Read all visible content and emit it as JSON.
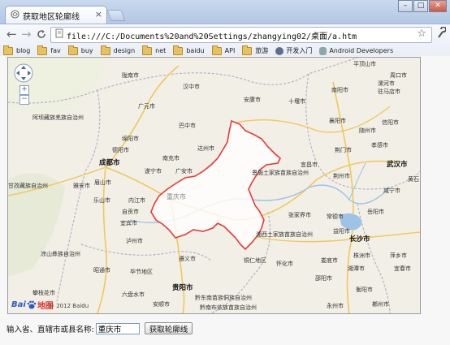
{
  "window": {
    "tab_title": "获取地区轮廓线",
    "tab_close": "×",
    "minimize": "–",
    "maximize": "□",
    "close": "✕"
  },
  "toolbar": {
    "back": "←",
    "forward": "→",
    "reload": "C",
    "url": "file:///C:/Documents%20and%20Settings/zhangying02/桌面/a.htm",
    "star": "☆"
  },
  "bookmarks": [
    {
      "label": "blog",
      "icon": "folder-icon"
    },
    {
      "label": "fav",
      "icon": "folder-icon"
    },
    {
      "label": "buy",
      "icon": "folder-icon"
    },
    {
      "label": "design",
      "icon": "folder-icon"
    },
    {
      "label": "net",
      "icon": "folder-icon"
    },
    {
      "label": "baidu",
      "icon": "folder-icon"
    },
    {
      "label": "API",
      "icon": "folder-icon"
    },
    {
      "label": "旅游",
      "icon": "folder-icon"
    },
    {
      "label": "开发入门",
      "icon": "globe-icon"
    },
    {
      "label": "Android Developers",
      "icon": "android-icon"
    }
  ],
  "map": {
    "zoom_in": "+",
    "zoom_out": "−",
    "logo_left": "Bai",
    "logo_right": "地图",
    "copyright": "© 2012 Baidu",
    "highlight_color": "#e53935",
    "places": {
      "pingdingshan": "平顶山市",
      "longnan": "陇南市",
      "hanzhong": "汉中市",
      "ankang": "安康市",
      "nanyang": "南阳市",
      "zhoukou": "周口市",
      "luohe": "漯河市",
      "zhumadian": "驻马店市",
      "shiyan": "十堰市",
      "guangyuan": "广元市",
      "xiangyang": "襄阳市",
      "xinyang": "信阳市",
      "aba": "阿坝藏族羌族自治州",
      "bazhong": "巴中市",
      "suizhou": "随州市",
      "mianyang": "绵阳市",
      "dazhou": "达州市",
      "xiaogan": "孝感市",
      "deyang": "德阳市",
      "jingmen": "荆门市",
      "chengdu": "成都市",
      "nanchong": "南充市",
      "suining": "遂宁市",
      "guang_an": "广安市",
      "wuhan": "武汉市",
      "enshi": "恩施土家族苗族自治州",
      "yichang": "宜昌市",
      "jingzhou": "荆州市",
      "xianning": "咸宁市",
      "huangshi": "黄石",
      "ganzi": "甘孜藏族自治州",
      "yaan": "雅安市",
      "meishan": "眉山市",
      "leshan": "乐山市",
      "neijiang": "内江市",
      "chongqing": "重庆市",
      "zigong": "自贡市",
      "zhangjiajie": "张家界市",
      "changde": "常德市",
      "yueyang": "岳阳市",
      "yibin": "宜宾市",
      "xiangxi": "湘西土家族苗族自治州",
      "yiyang": "益阳市",
      "changsha": "长沙市",
      "liangshan": "凉山彝族自治州",
      "luzhou": "泸州市",
      "zunyi": "遵义市",
      "tongren": "铜仁地区",
      "huaihua": "怀化市",
      "loudi": "娄底市",
      "zhuzhou": "株洲市",
      "pingxiang": "萍乡市",
      "zhaotong": "昭通市",
      "bijie": "毕节地区",
      "xiangtan": "湘潭市",
      "yichun": "宜春市",
      "shaoyang": "邵阳市",
      "panzhihua": "攀枝花市",
      "liupanshui": "六盘水市",
      "guiyang": "贵阳市",
      "qiandongnan": "黔东南苗族侗族自治州",
      "hengyang": "衡阳市",
      "anshun": "安顺市",
      "qiannan": "黔南布依族苗族自治州",
      "chenzhou": "郴州市",
      "yongzhou": "永州市"
    }
  },
  "form": {
    "label": "输入省、直辖市或县名称:",
    "city_value": "重庆市",
    "button": "获取轮廓线"
  }
}
